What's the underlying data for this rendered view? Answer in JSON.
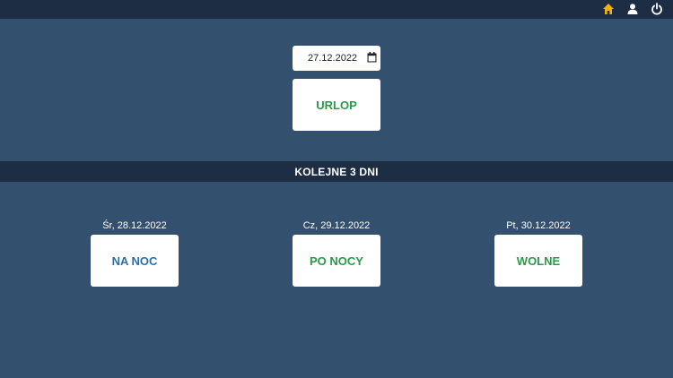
{
  "topbar": {
    "icons": [
      "home-icon",
      "user-icon",
      "power-icon"
    ],
    "home_color": "#f0b400"
  },
  "main": {
    "date_value": "27.12.2022",
    "status_button": "URLOP"
  },
  "banner": {
    "title": "KOLEJNE 3 DNI"
  },
  "days": [
    {
      "label": "Śr, 28.12.2022",
      "status": "NA NOC",
      "color": "#2d6fa6"
    },
    {
      "label": "Cz, 29.12.2022",
      "status": "PO NOCY",
      "color": "#2a9a4a"
    },
    {
      "label": "Pt, 30.12.2022",
      "status": "WOLNE",
      "color": "#2a9a4a"
    }
  ],
  "colors": {
    "background": "#34506f",
    "bar": "#1d2d43",
    "green": "#2a9a4a",
    "blue": "#2d6fa6"
  }
}
